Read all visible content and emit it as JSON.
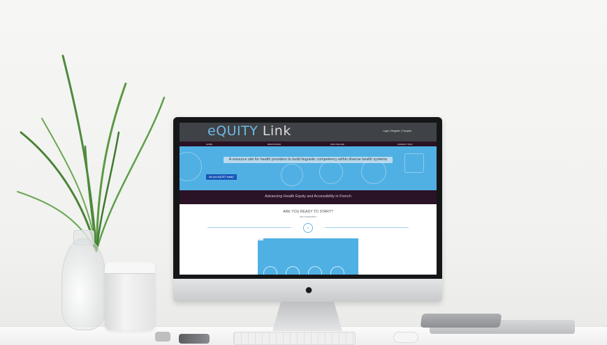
{
  "site": {
    "logo_prefix": "eQUITY",
    "logo_suffix": " Link",
    "top_links": "Login | Register | Français",
    "nav": [
      "HOME",
      "RESOURCES",
      "WHO WE ARE",
      "ASSESS YOUR"
    ],
    "hero_text": "A resource site for health providers to build linguistic competency within diverse health systems",
    "hero_button": "Are you eQUITY ready?",
    "band_text": "Advancing Health Equity and Accessibility in French",
    "ready_title": "ARE YOU READY TO START?",
    "ready_sub": "SELF ASSESSMENT",
    "scroll_icon": "chevron-down-icon"
  },
  "colors": {
    "header": "#3f4246",
    "nav": "#2a1224",
    "hero": "#50b0e3",
    "band": "#2b1327",
    "button": "#1b57b8",
    "logo_accent": "#6fb8e6"
  },
  "apple_logo": "",
  "icons": [
    "apple-logo-icon",
    "chevron-down-icon"
  ]
}
